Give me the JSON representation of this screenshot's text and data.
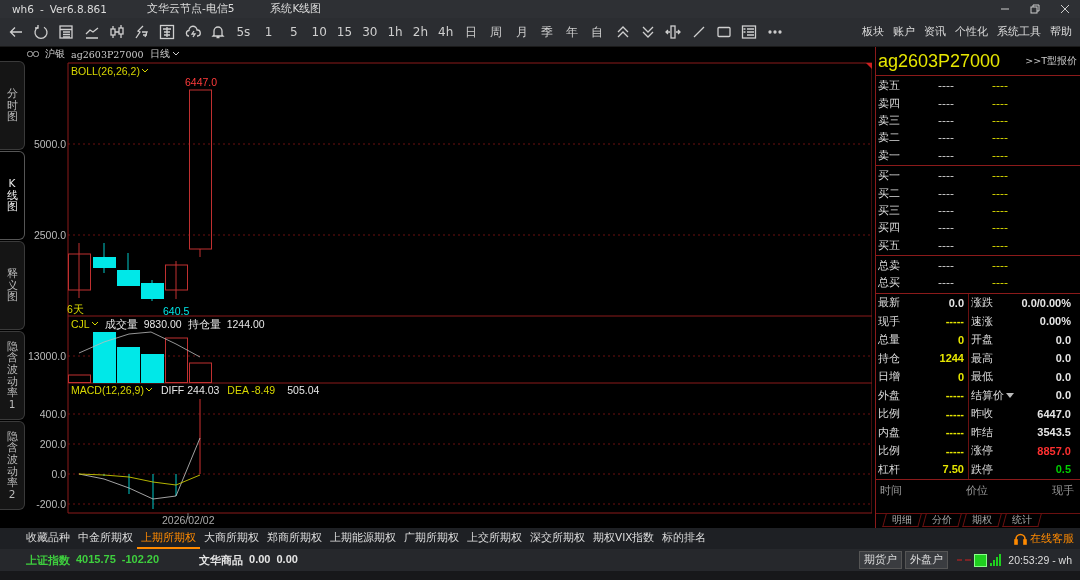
{
  "window": {
    "app": "wh6",
    "separator": "-",
    "version": "Ver6.8.861",
    "server": "文华云节点-电信5",
    "view": "系统K线图"
  },
  "toolbar": {
    "periods": [
      "5s",
      "1",
      "5",
      "10",
      "15",
      "30",
      "1h",
      "2h",
      "4h",
      "日",
      "周",
      "月",
      "季",
      "年",
      "自"
    ],
    "menu": [
      "板块",
      "账户",
      "资讯",
      "个性化",
      "系统工具",
      "帮助"
    ]
  },
  "chart_header": {
    "exchange": "沪银",
    "symbol": "ag2603P27000",
    "period": "日线"
  },
  "side_tabs": [
    {
      "label": "分时图",
      "selected": false
    },
    {
      "label": "K线图",
      "selected": true
    },
    {
      "label": "释义图",
      "selected": false
    },
    {
      "label": "隐含波动率1",
      "selected": false
    },
    {
      "label": "隐含波动率2",
      "selected": false
    }
  ],
  "chart": {
    "main": {
      "indicator": "BOLL(26,26,2)",
      "yticks": [
        "5000.0",
        "2500.0"
      ],
      "high_label": "6447.0",
      "low_label": "640.5",
      "span_label": "6天"
    },
    "volume": {
      "indicator": "CJL",
      "fields": [
        {
          "label": "成交量",
          "value": "9830.00"
        },
        {
          "label": "持仓量",
          "value": "1244.00"
        }
      ],
      "yticks": [
        "13000.0"
      ]
    },
    "macd": {
      "indicator": "MACD(12,26,9)",
      "diff": "DIFF 244.03",
      "dea": "DEA -8.49",
      "macd": "505.04",
      "yticks": [
        "400.0",
        "200.0",
        "0.0",
        "-200.0"
      ]
    },
    "date": "2026/02/02"
  },
  "quote": {
    "symbol": "ag2603P27000",
    "t_link": ">>T型报价",
    "asks": [
      {
        "label": "卖五",
        "price": "----",
        "volume": "----"
      },
      {
        "label": "卖四",
        "price": "----",
        "volume": "----"
      },
      {
        "label": "卖三",
        "price": "----",
        "volume": "----"
      },
      {
        "label": "卖二",
        "price": "----",
        "volume": "----"
      },
      {
        "label": "卖一",
        "price": "----",
        "volume": "----"
      }
    ],
    "bids": [
      {
        "label": "买一",
        "price": "----",
        "volume": "----"
      },
      {
        "label": "买二",
        "price": "----",
        "volume": "----"
      },
      {
        "label": "买三",
        "price": "----",
        "volume": "----"
      },
      {
        "label": "买四",
        "price": "----",
        "volume": "----"
      },
      {
        "label": "买五",
        "price": "----",
        "volume": "----"
      }
    ],
    "totals": [
      {
        "label": "总卖",
        "price": "----",
        "volume": "----"
      },
      {
        "label": "总买",
        "price": "----",
        "volume": "----"
      }
    ],
    "stats": [
      {
        "left": {
          "label": "最新",
          "value": "0.0",
          "color": "#e6e6e6"
        },
        "right": {
          "label": "涨跌",
          "value": "0.0/0.00%",
          "color": "#e6e6e6",
          "dropdown": false
        }
      },
      {
        "left": {
          "label": "现手",
          "value": "-----",
          "color": "#e6e600"
        },
        "right": {
          "label": "速涨",
          "value": "0.00%",
          "color": "#e6e6e6",
          "dropdown": false
        }
      },
      {
        "left": {
          "label": "总量",
          "value": "0",
          "color": "#e6e600"
        },
        "right": {
          "label": "开盘",
          "value": "0.0",
          "color": "#e6e6e6",
          "dropdown": false
        }
      },
      {
        "left": {
          "label": "持仓",
          "value": "1244",
          "color": "#e6e600"
        },
        "right": {
          "label": "最高",
          "value": "0.0",
          "color": "#e6e6e6",
          "dropdown": false
        }
      },
      {
        "left": {
          "label": "日增",
          "value": "0",
          "color": "#e6e600"
        },
        "right": {
          "label": "最低",
          "value": "0.0",
          "color": "#e6e6e6",
          "dropdown": false
        }
      },
      {
        "left": {
          "label": "外盘",
          "value": "-----",
          "color": "#e6e600"
        },
        "right": {
          "label": "结算价",
          "value": "0.0",
          "color": "#e6e6e6",
          "dropdown": true
        }
      },
      {
        "left": {
          "label": "比例",
          "value": "-----",
          "color": "#e6e600"
        },
        "right": {
          "label": "昨收",
          "value": "6447.0",
          "color": "#e6e6e6",
          "dropdown": false
        }
      },
      {
        "left": {
          "label": "内盘",
          "value": "-----",
          "color": "#e6e600"
        },
        "right": {
          "label": "昨结",
          "value": "3543.5",
          "color": "#e6e6e6",
          "dropdown": false
        }
      },
      {
        "left": {
          "label": "比例",
          "value": "-----",
          "color": "#e6e600"
        },
        "right": {
          "label": "涨停",
          "value": "8857.0",
          "color": "#ff3030",
          "dropdown": false
        }
      },
      {
        "left": {
          "label": "杠杆",
          "value": "7.50",
          "color": "#e6e600"
        },
        "right": {
          "label": "跌停",
          "value": "0.5",
          "color": "#00d000",
          "dropdown": false
        }
      }
    ],
    "ticks_header": [
      "时间",
      "价位",
      "现手"
    ],
    "tabs": [
      "明细",
      "分价",
      "期权",
      "统计"
    ]
  },
  "exchange_tabs": [
    {
      "label": "收藏品种",
      "selected": false
    },
    {
      "label": "中金所期权",
      "selected": false
    },
    {
      "label": "上期所期权",
      "selected": true
    },
    {
      "label": "大商所期权",
      "selected": false
    },
    {
      "label": "郑商所期权",
      "selected": false
    },
    {
      "label": "上期能源期权",
      "selected": false
    },
    {
      "label": "广期所期权",
      "selected": false
    },
    {
      "label": "上交所期权",
      "selected": false
    },
    {
      "label": "深交所期权",
      "selected": false
    },
    {
      "label": "期权VIX指数",
      "selected": false
    },
    {
      "label": "标的排名",
      "selected": false
    }
  ],
  "service": "在线客服",
  "status_bar": {
    "indices": [
      {
        "name": "上证指数",
        "value": "4015.75",
        "change": "-102.20",
        "color": "#3ecf3e"
      },
      {
        "name": "文华商品",
        "value": "0.00",
        "change": "0.00",
        "color": "#e6e6e6"
      }
    ],
    "buttons": [
      "期货户",
      "外盘户"
    ],
    "time": "20:53:29 - wh"
  }
}
